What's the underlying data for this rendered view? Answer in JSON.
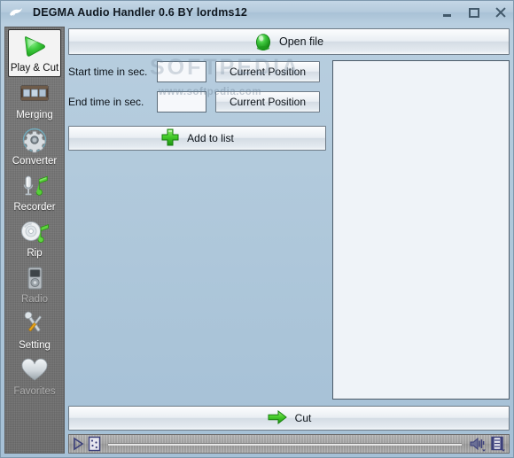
{
  "window": {
    "title": "DEGMA Audio Handler 0.6 BY lordms12",
    "app_icon": "dove-icon",
    "controls": {
      "minimize": "minimize-icon",
      "maximize": "maximize-icon",
      "close": "close-icon"
    }
  },
  "sidebar": {
    "items": [
      {
        "label": "Play & Cut",
        "icon": "play-triangle-icon",
        "selected": true,
        "enabled": true
      },
      {
        "label": "Merging",
        "icon": "filmstrip-icon",
        "selected": false,
        "enabled": true
      },
      {
        "label": "Converter",
        "icon": "gear-icon",
        "selected": false,
        "enabled": true
      },
      {
        "label": "Recorder",
        "icon": "microphone-note-icon",
        "selected": false,
        "enabled": true
      },
      {
        "label": "Rip",
        "icon": "cd-note-icon",
        "selected": false,
        "enabled": true
      },
      {
        "label": "Radio",
        "icon": "radio-device-icon",
        "selected": false,
        "enabled": false
      },
      {
        "label": "Setting",
        "icon": "tools-icon",
        "selected": false,
        "enabled": true
      },
      {
        "label": "Favorites",
        "icon": "heart-icon",
        "selected": false,
        "enabled": false
      }
    ]
  },
  "main": {
    "open_file_label": "Open file",
    "open_file_icon": "green-egg-icon",
    "start_time_label": "Start time in sec.",
    "start_time_value": "",
    "start_time_placeholder": "",
    "end_time_label": "End time in sec.",
    "end_time_value": "",
    "end_time_placeholder": "",
    "current_position_start_label": "Current Position",
    "current_position_end_label": "Current Position",
    "add_to_list_label": "Add to list",
    "add_to_list_icon": "green-plus-icon",
    "cut_label": "Cut",
    "cut_icon": "green-arrow-right-icon",
    "list_items": []
  },
  "watermark": {
    "main": "SOFTPEDIA",
    "sub": "www.softpedia.com"
  },
  "player": {
    "play_icon": "play-icon",
    "eq_icon": "equalizer-icon",
    "volume_icon": "volume-icon",
    "playlist_icon": "film-playlist-icon",
    "seek_value": 0
  },
  "colors": {
    "accent_green": "#3ec43e",
    "titlebar": "#b4cadc",
    "panel_bg": "#eef2f7",
    "sidebar_bg": "#737373"
  }
}
